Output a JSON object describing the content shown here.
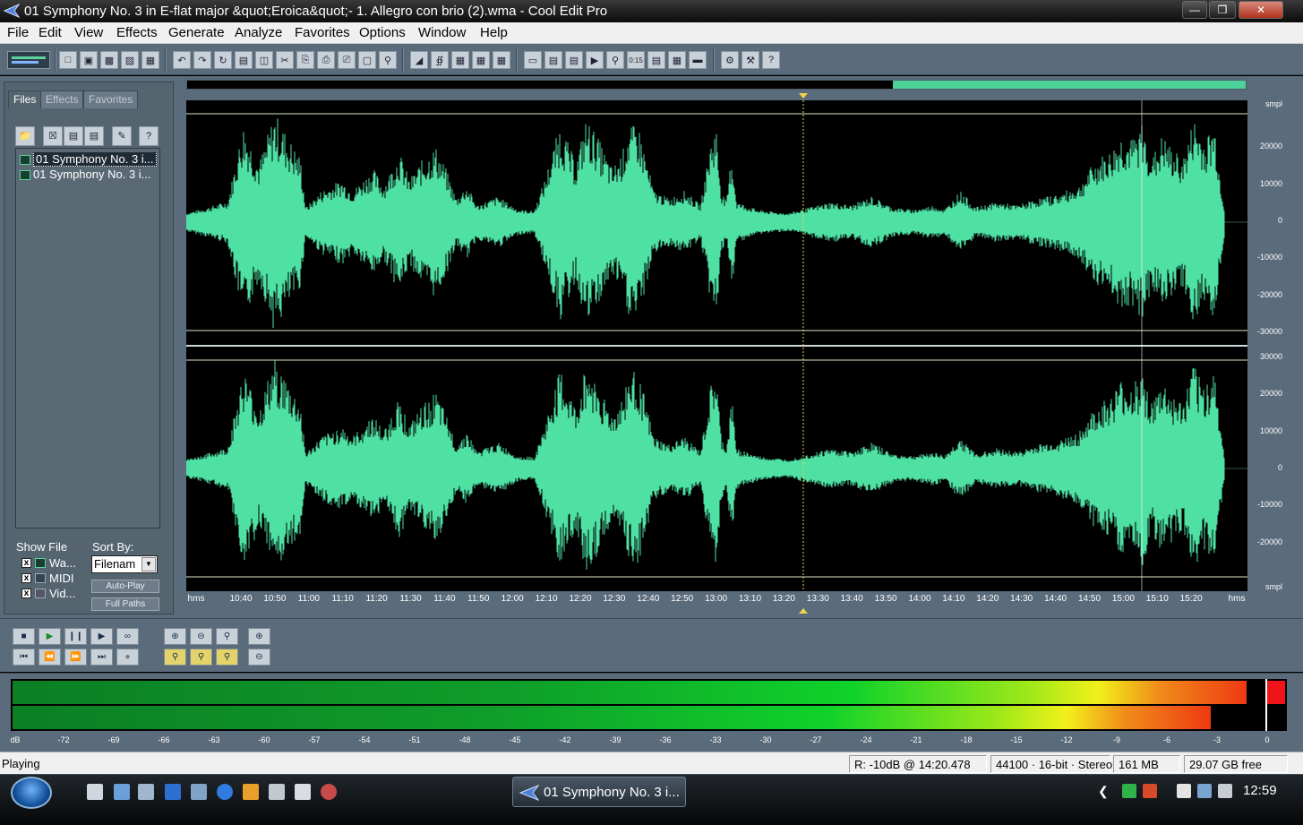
{
  "window": {
    "title": "01 Symphony No. 3 in E-flat major &quot;Eroica&quot;-  1. Allegro con brio (2).wma - Cool Edit Pro",
    "controls": [
      "minimize",
      "maximize",
      "close"
    ]
  },
  "menu": [
    "File",
    "Edit",
    "View",
    "Effects",
    "Generate",
    "Analyze",
    "Favorites",
    "Options",
    "Window",
    "Help"
  ],
  "side_panel": {
    "tabs": [
      "Files",
      "Effects",
      "Favorites"
    ],
    "active_tab": "Files",
    "files": [
      "01 Symphony No. 3 i...",
      "01 Symphony No. 3 i..."
    ],
    "show_file_label": "Show File",
    "show_file_options": [
      {
        "label": "Wa...",
        "checked": true,
        "icon": "wave-file-icon"
      },
      {
        "label": "MIDI",
        "checked": true,
        "icon": "midi-file-icon"
      },
      {
        "label": "Vid...",
        "checked": true,
        "icon": "video-file-icon"
      }
    ],
    "sort_by_label": "Sort By:",
    "sort_by_value": "Filenam",
    "auto_play_label": "Auto-Play",
    "full_paths_label": "Full Paths"
  },
  "waveform": {
    "amplitude_labels_top": [
      "smpl",
      "20000",
      "10000",
      "0",
      "-10000",
      "-20000",
      "-30000"
    ],
    "amplitude_labels_bottom": [
      "30000",
      "20000",
      "10000",
      "0",
      "-10000",
      "-20000",
      "smpl"
    ],
    "time_labels": [
      "hms",
      "10:40",
      "10:50",
      "11:00",
      "11:10",
      "11:20",
      "11:30",
      "11:40",
      "11:50",
      "12:00",
      "12:10",
      "12:20",
      "12:30",
      "12:40",
      "12:50",
      "13:00",
      "13:10",
      "13:20",
      "13:30",
      "13:40",
      "13:50",
      "14:00",
      "14:10",
      "14:20",
      "14:30",
      "14:40",
      "14:50",
      "15:00",
      "15:10",
      "15:20",
      "hms"
    ],
    "channels": 2,
    "color": "#4fe0a4",
    "cursor_time": "13:26"
  },
  "level_meter": {
    "scale": [
      "dB",
      "-72",
      "-69",
      "-66",
      "-63",
      "-60",
      "-57",
      "-54",
      "-51",
      "-48",
      "-45",
      "-42",
      "-39",
      "-36",
      "-33",
      "-30",
      "-27",
      "-24",
      "-21",
      "-18",
      "-15",
      "-12",
      "-9",
      "-6",
      "-3",
      "0"
    ],
    "left_level_db": -1,
    "right_level_db": -3,
    "clip_indicator": true
  },
  "status": {
    "state": "Playing",
    "peak": "R: -10dB @  14:20.478",
    "format": "44100 · 16-bit · Stereo",
    "size": "161 MB",
    "free": "29.07 GB free"
  },
  "taskbar": {
    "active_window": "01 Symphony No. 3 i...",
    "clock": "12:59"
  }
}
